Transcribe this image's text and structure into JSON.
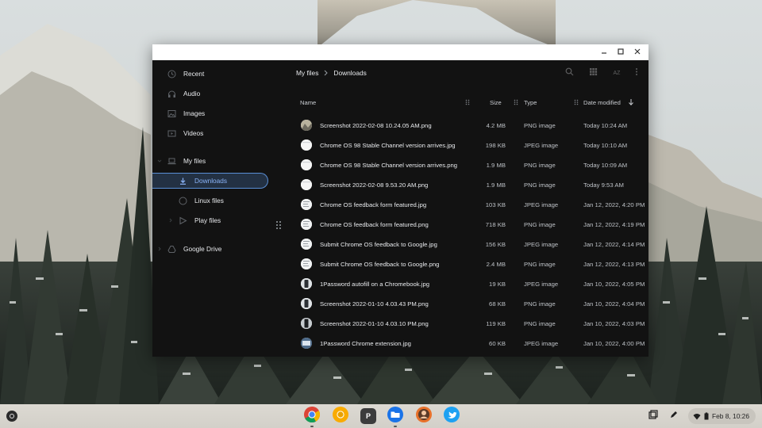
{
  "window": {
    "controls": {
      "minimize": "minimize-icon",
      "maximize": "maximize-icon",
      "close": "close-icon"
    }
  },
  "sidebar": {
    "items": [
      {
        "label": "Recent",
        "icon": "clock-icon"
      },
      {
        "label": "Audio",
        "icon": "headphones-icon"
      },
      {
        "label": "Images",
        "icon": "image-icon"
      },
      {
        "label": "Videos",
        "icon": "video-icon"
      },
      {
        "label": "My files",
        "icon": "laptop-icon"
      },
      {
        "label": "Downloads",
        "icon": "download-icon",
        "active": true
      },
      {
        "label": "Linux files",
        "icon": "linux-icon"
      },
      {
        "label": "Play files",
        "icon": "play-store-icon"
      },
      {
        "label": "Google Drive",
        "icon": "drive-icon"
      }
    ]
  },
  "breadcrumb": {
    "root": "My files",
    "current": "Downloads"
  },
  "toolbar": {
    "buttons": [
      "search-icon",
      "grid-view-icon",
      "sort-az-icon",
      "more-vert-icon"
    ],
    "sort_label": "AZ"
  },
  "columns": {
    "name": "Name",
    "size": "Size",
    "type": "Type",
    "date": "Date modified"
  },
  "files": [
    {
      "name": "Screenshot 2022-02-08 10.24.05 AM.png",
      "size": "4.2 MB",
      "type": "PNG image",
      "date": "Today 10:24 AM",
      "thumb": "mountain"
    },
    {
      "name": "Chrome OS 98 Stable Channel version arrives.jpg",
      "size": "198 KB",
      "type": "JPEG image",
      "date": "Today 10:10 AM",
      "thumb": "white"
    },
    {
      "name": "Chrome OS 98 Stable Channel version arrives.png",
      "size": "1.9 MB",
      "type": "PNG image",
      "date": "Today 10:09 AM",
      "thumb": "white"
    },
    {
      "name": "Screenshot 2022-02-08 9.53.20 AM.png",
      "size": "1.9 MB",
      "type": "PNG image",
      "date": "Today 9:53 AM",
      "thumb": "white"
    },
    {
      "name": "Chrome OS feedback form featured.jpg",
      "size": "103 KB",
      "type": "JPEG image",
      "date": "Jan 12, 2022, 4:20 PM",
      "thumb": "doc"
    },
    {
      "name": "Chrome OS feedback form featured.png",
      "size": "718 KB",
      "type": "PNG image",
      "date": "Jan 12, 2022, 4:19 PM",
      "thumb": "doc"
    },
    {
      "name": "Submit Chrome OS feedback to Google.jpg",
      "size": "156 KB",
      "type": "JPEG image",
      "date": "Jan 12, 2022, 4:14 PM",
      "thumb": "doc"
    },
    {
      "name": "Submit Chrome OS feedback to Google.png",
      "size": "2.4 MB",
      "type": "PNG image",
      "date": "Jan 12, 2022, 4:13 PM",
      "thumb": "doc"
    },
    {
      "name": "1Password autofill on a Chromebook.jpg",
      "size": "19 KB",
      "type": "JPEG image",
      "date": "Jan 10, 2022, 4:05 PM",
      "thumb": "phone"
    },
    {
      "name": "Screenshot 2022-01-10 4.03.43 PM.png",
      "size": "68 KB",
      "type": "PNG image",
      "date": "Jan 10, 2022, 4:04 PM",
      "thumb": "phone"
    },
    {
      "name": "Screenshot 2022-01-10 4.03.10 PM.png",
      "size": "119 KB",
      "type": "PNG image",
      "date": "Jan 10, 2022, 4:03 PM",
      "thumb": "phone-dark"
    },
    {
      "name": "1Password Chrome extension.jpg",
      "size": "60 KB",
      "type": "JPEG image",
      "date": "Jan 10, 2022, 4:00 PM",
      "thumb": "screen"
    }
  ],
  "shelf": {
    "apps": [
      "chrome-icon",
      "chrome-canary-icon",
      "pocket-casts-icon",
      "files-app-icon",
      "avatar-app-icon",
      "twitter-icon"
    ],
    "app_letter": "P",
    "tray": {
      "date_time": "Feb 8, 10:26"
    }
  },
  "colors": {
    "window_bg": "#121212",
    "accent": "#8ab4f8",
    "active_bg": "#233143",
    "shelf_bg": "#d8d5ce"
  }
}
